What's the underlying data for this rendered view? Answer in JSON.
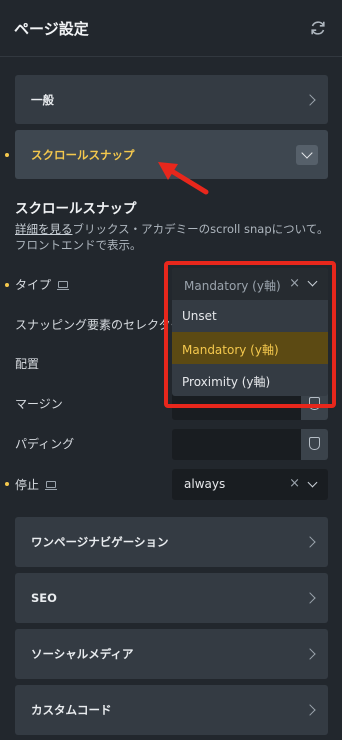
{
  "header": {
    "title": "ページ設定",
    "refresh_icon": "refresh-icon"
  },
  "panels": {
    "general": "一般",
    "scroll_snap": "スクロールスナップ",
    "one_page_nav": "ワンページナビゲーション",
    "seo": "SEO",
    "social_media": "ソーシャルメディア",
    "custom_code": "カスタムコード"
  },
  "section": {
    "title": "スクロールスナップ",
    "desc_link": "詳細を見る",
    "desc_text": "ブリックス・アカデミーのscroll snapについて。 フロントエンドで表示。"
  },
  "rows": {
    "type": "タイプ",
    "snap_selector": "スナッピング要素のセレクター",
    "alignment": "配置",
    "margin": "マージン",
    "padding": "パディング",
    "stop": "停止"
  },
  "type_select": {
    "value": "Mandatory (y軸)",
    "clear": "×",
    "options": [
      "Unset",
      "Mandatory (y軸)",
      "Proximity (y軸)"
    ]
  },
  "stop_select": {
    "value": "always",
    "clear": "×"
  },
  "colors": {
    "accent": "#f4c84d",
    "annotation_red": "#e8271c",
    "background": "#22272d"
  }
}
